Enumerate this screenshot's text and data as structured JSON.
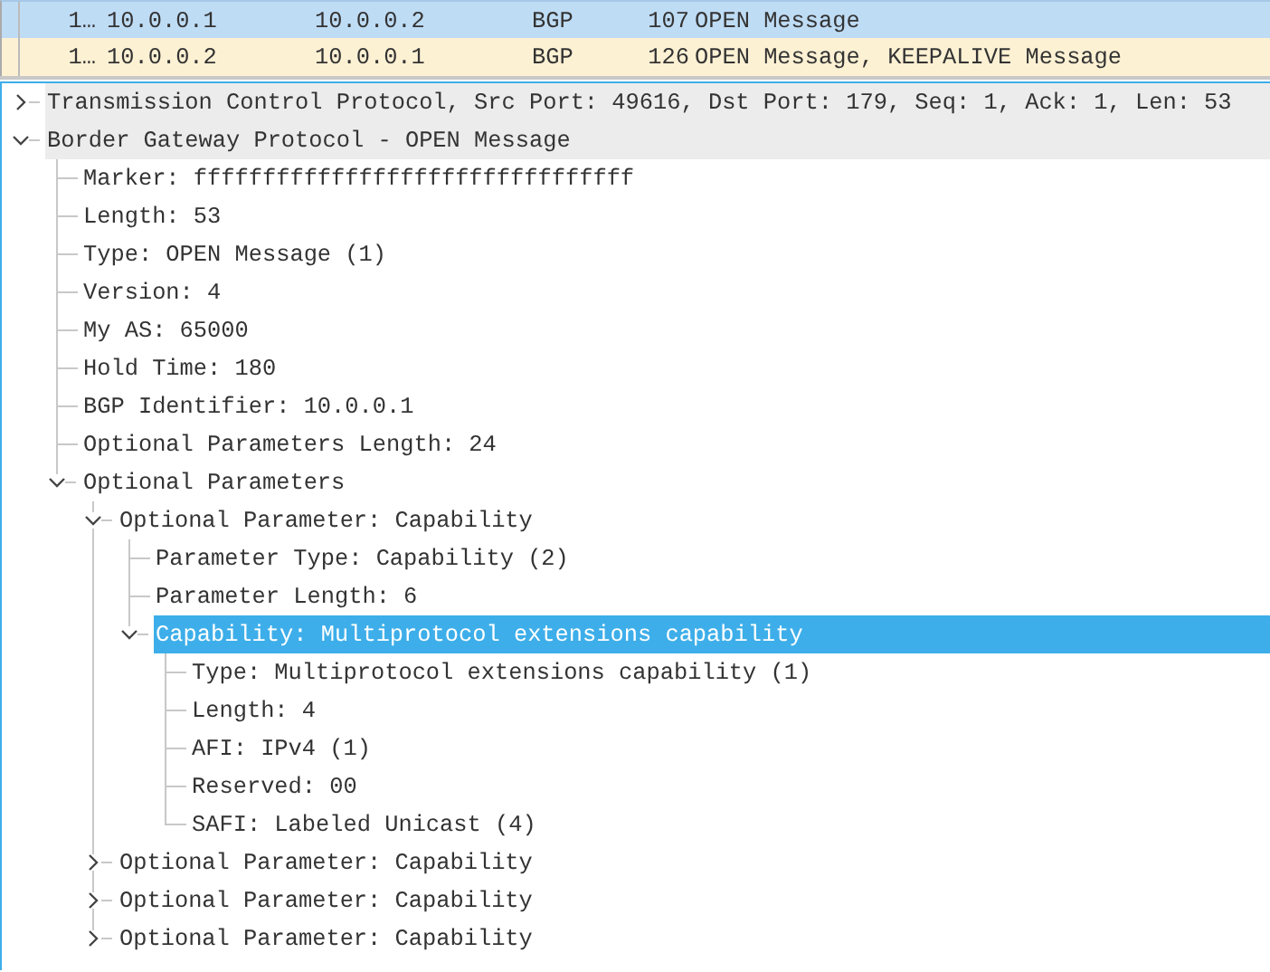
{
  "packet_list": {
    "rows": [
      {
        "number": "1…",
        "source": "10.0.0.1",
        "destination": "10.0.0.2",
        "protocol": "BGP",
        "length": "107",
        "info": "OPEN Message",
        "selected": true
      },
      {
        "number": "1…",
        "source": "10.0.0.2",
        "destination": "10.0.0.1",
        "protocol": "BGP",
        "length": "126",
        "info": "OPEN Message, KEEPALIVE Message",
        "selected": false
      }
    ]
  },
  "packet_details": {
    "tree": [
      {
        "label": "Transmission Control Protocol, Src Port: 49616, Dst Port: 179, Seq: 1, Ack: 1, Len: 53",
        "expanded": false,
        "selected": false
      },
      {
        "label": "Border Gateway Protocol - OPEN Message",
        "expanded": true,
        "selected": false,
        "children": [
          {
            "label": "Marker: ffffffffffffffffffffffffffffffff",
            "selected": false
          },
          {
            "label": "Length: 53",
            "selected": false
          },
          {
            "label": "Type: OPEN Message (1)",
            "selected": false
          },
          {
            "label": "Version: 4",
            "selected": false
          },
          {
            "label": "My AS: 65000",
            "selected": false
          },
          {
            "label": "Hold Time: 180",
            "selected": false
          },
          {
            "label": "BGP Identifier: 10.0.0.1",
            "selected": false
          },
          {
            "label": "Optional Parameters Length: 24",
            "selected": false
          },
          {
            "label": "Optional Parameters",
            "expanded": true,
            "selected": false,
            "children": [
              {
                "label": "Optional Parameter: Capability",
                "expanded": true,
                "selected": false,
                "children": [
                  {
                    "label": "Parameter Type: Capability (2)",
                    "selected": false
                  },
                  {
                    "label": "Parameter Length: 6",
                    "selected": false
                  },
                  {
                    "label": "Capability: Multiprotocol extensions capability",
                    "expanded": true,
                    "selected": true,
                    "children": [
                      {
                        "label": "Type: Multiprotocol extensions capability (1)",
                        "selected": false
                      },
                      {
                        "label": "Length: 4",
                        "selected": false
                      },
                      {
                        "label": "AFI: IPv4 (1)",
                        "selected": false
                      },
                      {
                        "label": "Reserved: 00",
                        "selected": false
                      },
                      {
                        "label": "SAFI: Labeled Unicast (4)",
                        "selected": false
                      }
                    ]
                  }
                ]
              },
              {
                "label": "Optional Parameter: Capability",
                "expanded": false,
                "selected": false
              },
              {
                "label": "Optional Parameter: Capability",
                "expanded": false,
                "selected": false
              },
              {
                "label": "Optional Parameter: Capability",
                "expanded": false,
                "selected": false
              }
            ]
          }
        ]
      }
    ]
  }
}
